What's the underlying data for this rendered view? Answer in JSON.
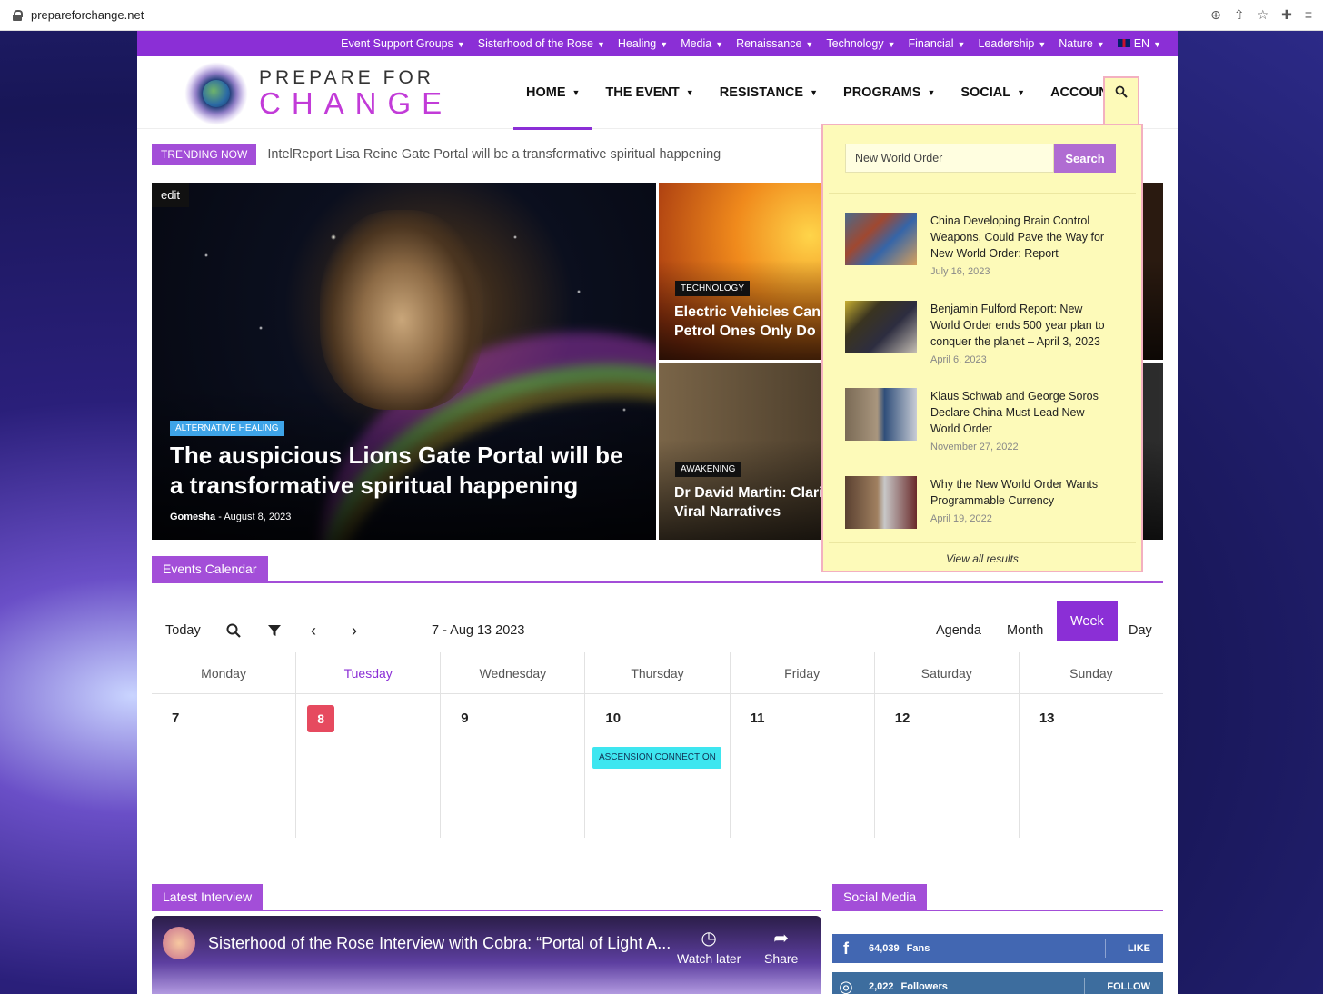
{
  "browser": {
    "url": "prepareforchange.net"
  },
  "topnav": [
    {
      "label": "Event Support Groups"
    },
    {
      "label": "Sisterhood of the Rose"
    },
    {
      "label": "Healing"
    },
    {
      "label": "Media"
    },
    {
      "label": "Renaissance"
    },
    {
      "label": "Technology"
    },
    {
      "label": "Financial"
    },
    {
      "label": "Leadership"
    },
    {
      "label": "Nature"
    },
    {
      "label": "EN"
    }
  ],
  "logo": {
    "line1": "PREPARE FOR",
    "line2": "CHANGE"
  },
  "mainnav": [
    {
      "label": "HOME"
    },
    {
      "label": "THE EVENT"
    },
    {
      "label": "RESISTANCE"
    },
    {
      "label": "PROGRAMS"
    },
    {
      "label": "SOCIAL"
    },
    {
      "label": "ACCOUNT"
    }
  ],
  "trending": {
    "badge": "TRENDING NOW",
    "text": "IntelReport Lisa Reine Gate Portal will be a transformative spiritual happening"
  },
  "hero": {
    "edit": "edit",
    "category": "ALTERNATIVE HEALING",
    "title": "The auspicious Lions Gate Portal will be a transformative spiritual happening",
    "author": "Gomesha",
    "date": "August 8, 2023"
  },
  "tiles": [
    {
      "category": "TECHNOLOGY",
      "title_l1": "Electric Vehicles Can Ex",
      "title_l2": "Petrol Ones Only Do It In"
    },
    {
      "category": "AWAKENING",
      "title_l1": "Dr David Martin: Clarifyi",
      "title_l2": "Viral Narratives"
    }
  ],
  "events": {
    "section": "Events Calendar"
  },
  "calendar": {
    "today_label": "Today",
    "range": "7 - Aug 13 2023",
    "views": {
      "agenda": "Agenda",
      "month": "Month",
      "week": "Week",
      "day": "Day"
    },
    "days": [
      {
        "name": "Monday",
        "num": "7"
      },
      {
        "name": "Tuesday",
        "num": "8"
      },
      {
        "name": "Wednesday",
        "num": "9"
      },
      {
        "name": "Thursday",
        "num": "10"
      },
      {
        "name": "Friday",
        "num": "11"
      },
      {
        "name": "Saturday",
        "num": "12"
      },
      {
        "name": "Sunday",
        "num": "13"
      }
    ],
    "event": "ASCENSION CONNECTION"
  },
  "interview": {
    "section": "Latest Interview",
    "video_title": "Sisterhood of the Rose Interview with Cobra: “Portal of Light A...",
    "watch_later": "Watch later",
    "share": "Share"
  },
  "social": {
    "section": "Social Media",
    "facebook": {
      "count": "64,039",
      "label": "Fans",
      "action": "LIKE"
    },
    "instagram": {
      "count": "2,022",
      "label": "Followers",
      "action": "FOLLOW"
    }
  },
  "search": {
    "value": "New World Order",
    "button": "Search",
    "results": [
      {
        "title": "China Developing Brain Control Weapons, Could Pave the Way for New World Order: Report",
        "date": "July 16, 2023"
      },
      {
        "title": "Benjamin Fulford Report: New World Order ends 500 year plan to conquer the planet – April 3, 2023",
        "date": "April 6, 2023"
      },
      {
        "title": "Klaus Schwab and George Soros Declare China Must Lead New World Order",
        "date": "November 27, 2022"
      },
      {
        "title": "Why the New World Order Wants Programmable Currency",
        "date": "April 19, 2022"
      }
    ],
    "view_all": "View all results"
  },
  "colors": {
    "accent": "#8b2fd6",
    "search_bg": "#fdfab9",
    "today": "#e64a5f",
    "event": "#3ee6f0"
  }
}
